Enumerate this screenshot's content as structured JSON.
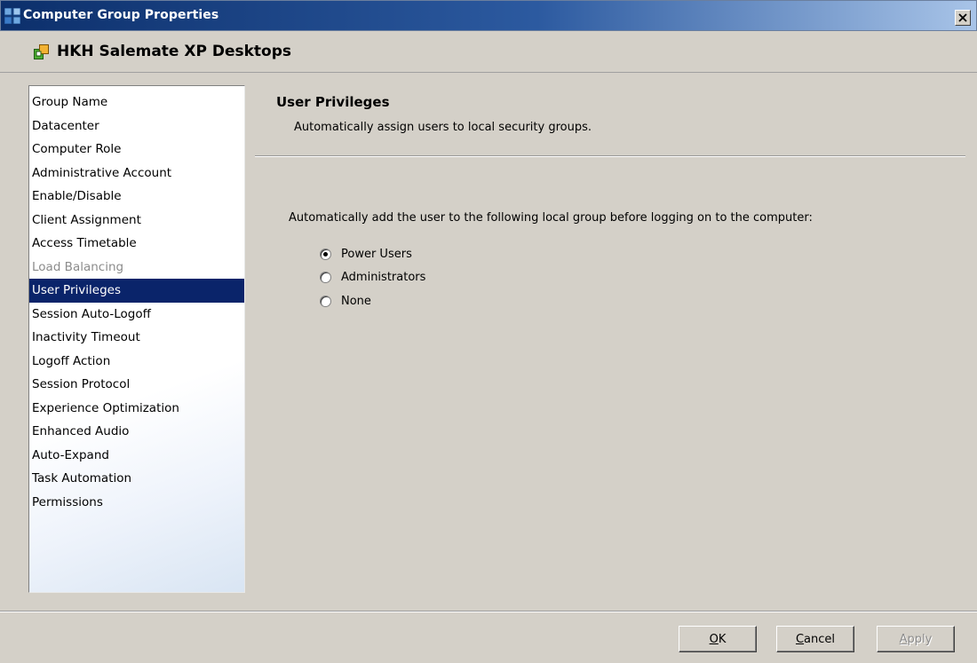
{
  "window": {
    "title": "Computer Group Properties",
    "group_name": "HKH Salemate XP Desktops"
  },
  "nav": {
    "items": [
      {
        "label": "Group Name",
        "state": "normal"
      },
      {
        "label": "Datacenter",
        "state": "normal"
      },
      {
        "label": "Computer Role",
        "state": "normal"
      },
      {
        "label": "Administrative Account",
        "state": "normal"
      },
      {
        "label": "Enable/Disable",
        "state": "normal"
      },
      {
        "label": "Client Assignment",
        "state": "normal"
      },
      {
        "label": "Access Timetable",
        "state": "normal"
      },
      {
        "label": "Load Balancing",
        "state": "disabled"
      },
      {
        "label": "User Privileges",
        "state": "selected"
      },
      {
        "label": "Session Auto-Logoff",
        "state": "normal"
      },
      {
        "label": "Inactivity Timeout",
        "state": "normal"
      },
      {
        "label": "Logoff Action",
        "state": "normal"
      },
      {
        "label": "Session Protocol",
        "state": "normal"
      },
      {
        "label": "Experience Optimization",
        "state": "normal"
      },
      {
        "label": "Enhanced Audio",
        "state": "normal"
      },
      {
        "label": "Auto-Expand",
        "state": "normal"
      },
      {
        "label": "Task Automation",
        "state": "normal"
      },
      {
        "label": "Permissions",
        "state": "normal"
      }
    ]
  },
  "content": {
    "title": "User Privileges",
    "description": "Automatically assign users to local security groups.",
    "prompt": "Automatically add the user to the following local group before logging on to the computer:",
    "options": [
      {
        "label": "Power Users",
        "checked": true
      },
      {
        "label": "Administrators",
        "checked": false
      },
      {
        "label": "None",
        "checked": false
      }
    ]
  },
  "buttons": {
    "ok": {
      "mnemonic": "O",
      "rest": "K"
    },
    "cancel": {
      "mnemonic": "C",
      "rest": "ancel"
    },
    "apply": {
      "mnemonic": "A",
      "rest": "pply",
      "enabled": false
    }
  },
  "colors": {
    "selection": "#0a246a",
    "face": "#d4d0c8",
    "disabled_text": "#8c8c8c"
  }
}
